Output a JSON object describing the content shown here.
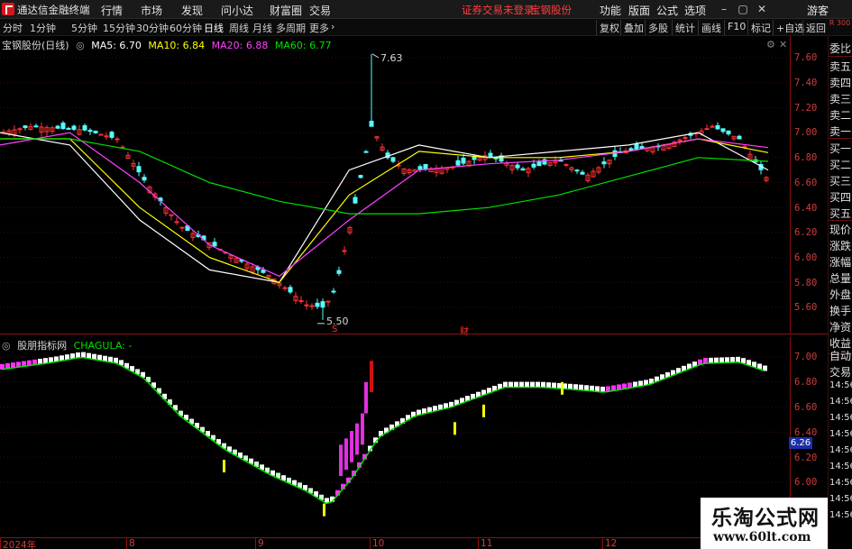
{
  "titlebar": {
    "app_name": "通达信金融终端",
    "menus": [
      "行情",
      "市场",
      "发现",
      "问小达",
      "财富圈",
      "交易"
    ],
    "notice": "证券交易未登录",
    "stock": "宝钢股份",
    "right_menus": [
      "功能",
      "版面",
      "公式",
      "选项"
    ],
    "guest": "游客"
  },
  "periodbar": {
    "periods": [
      "分时",
      "1分钟",
      "5分钟",
      "15分钟",
      "30分钟",
      "60分钟",
      "日线",
      "周线",
      "月线",
      "多周期",
      "更多"
    ],
    "active": "日线",
    "right_buttons": [
      "复权",
      "叠加",
      "多股",
      "统计",
      "画线",
      "F10",
      "标记",
      "+自选",
      "返回"
    ],
    "zoom_label": "R 300"
  },
  "main_legend": {
    "title": "宝钢股份(日线)",
    "ma": [
      {
        "label": "MA5: 6.70",
        "color": "#ffffff"
      },
      {
        "label": "MA10: 6.84",
        "color": "#ffff00"
      },
      {
        "label": "MA20: 6.88",
        "color": "#ff40ff"
      },
      {
        "label": "MA60: 6.77",
        "color": "#00e000"
      }
    ]
  },
  "sub_legend": {
    "title": "股朋指标网",
    "indicator": "CHAGULA: -"
  },
  "annotations": {
    "high": "7.63",
    "low": "5.50",
    "marker_s": "S",
    "marker_cai": "财"
  },
  "main_axis": {
    "ticks": [
      "7.60",
      "7.40",
      "7.20",
      "7.00",
      "6.80",
      "6.60",
      "6.40",
      "6.20",
      "6.00",
      "5.80",
      "5.60"
    ]
  },
  "sub_axis": {
    "ticks": [
      "7.00",
      "6.80",
      "6.60",
      "6.40",
      "6.20",
      "6.00"
    ],
    "current": "6.26"
  },
  "side_panel": {
    "items": [
      "委比",
      "卖五",
      "卖四",
      "卖三",
      "卖二",
      "卖一",
      "买一",
      "买二",
      "买三",
      "买四",
      "买五",
      "现价",
      "涨跌",
      "涨幅",
      "总量",
      "外盘",
      "换手",
      "净资",
      "收益",
      "自动",
      "交易"
    ],
    "time_items": [
      "14:56",
      "14:56",
      "14:56",
      "14:56",
      "14:56",
      "14:56",
      "14:56",
      "14:56",
      "14:56"
    ]
  },
  "date_axis": {
    "labels": [
      "2024年",
      "8",
      "9",
      "10",
      "11",
      "12"
    ]
  },
  "watermark": {
    "line1": "乐淘公式网",
    "line2": "www.60lt.com"
  },
  "colors": {
    "up": "#ff3232",
    "down": "#54ffff",
    "ma5": "#ffffff",
    "ma10": "#ffff00",
    "ma20": "#ff40ff",
    "ma60": "#00e000",
    "axis": "#d23c3c"
  },
  "chart_data": {
    "type": "line",
    "title": "宝钢股份(日线)",
    "xlabel": "",
    "ylabel": "",
    "x": [
      "2024年",
      "8",
      "9",
      "10",
      "11",
      "12"
    ],
    "ylim": [
      5.5,
      7.7
    ],
    "series": [
      {
        "name": "MA5",
        "values": [
          7.0,
          6.9,
          6.3,
          5.9,
          5.8,
          6.7,
          6.9,
          6.8,
          6.85,
          6.9,
          7.0,
          6.7
        ]
      },
      {
        "name": "MA10",
        "values": [
          6.95,
          6.95,
          6.4,
          6.0,
          5.8,
          6.5,
          6.85,
          6.8,
          6.8,
          6.85,
          6.95,
          6.84
        ]
      },
      {
        "name": "MA20",
        "values": [
          6.9,
          7.0,
          6.6,
          6.1,
          5.85,
          6.3,
          6.7,
          6.75,
          6.78,
          6.85,
          6.95,
          6.88
        ]
      },
      {
        "name": "MA60",
        "values": [
          6.95,
          6.95,
          6.85,
          6.6,
          6.45,
          6.35,
          6.35,
          6.4,
          6.5,
          6.65,
          6.8,
          6.77
        ]
      }
    ]
  }
}
